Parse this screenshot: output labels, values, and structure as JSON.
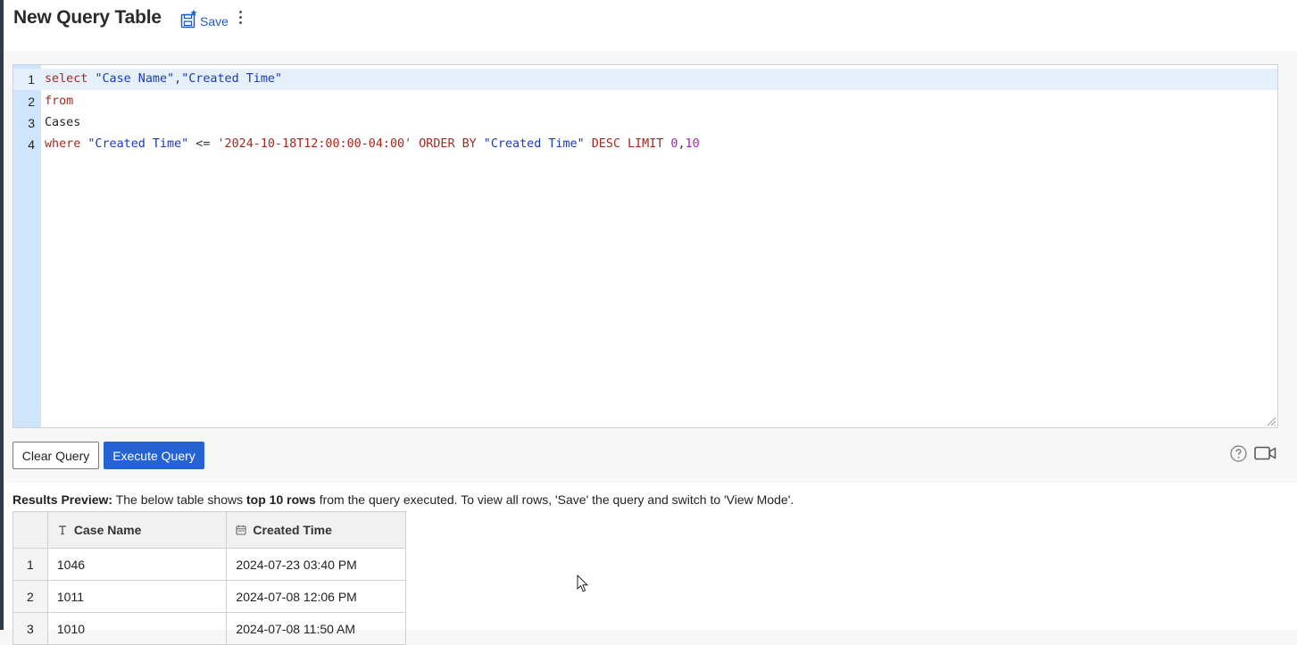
{
  "header": {
    "title": "New Query Table",
    "save_label": "Save"
  },
  "editor": {
    "lines": [
      {
        "number": "1"
      },
      {
        "number": "2"
      },
      {
        "number": "3"
      },
      {
        "number": "4"
      }
    ],
    "tokens": {
      "l1_kw": "select ",
      "l1_s1": "\"Case Name\"",
      "l1_comma": ",",
      "l1_s2": "\"Created Time\"",
      "l2_kw": "from",
      "l3_plain": "Cases",
      "l4_kw1": "where ",
      "l4_s1": "\"Created Time\"",
      "l4_op": " <= ",
      "l4_date": "'2024-10-18T12:00:00-04:00'",
      "l4_kw2": " ORDER BY ",
      "l4_s2": "\"Created Time\"",
      "l4_kw3": " DESC LIMIT ",
      "l4_n1": "0",
      "l4_comma": ",",
      "l4_n2": "10"
    }
  },
  "buttons": {
    "clear": "Clear Query",
    "execute": "Execute Query"
  },
  "results": {
    "note_label": "Results Preview:",
    "note_part1": " The below table shows ",
    "note_bold": "top 10 rows",
    "note_part2": " from the query executed. To view all rows, 'Save' the query and switch to 'View Mode'.",
    "columns": [
      "Case Name",
      "Created Time"
    ],
    "rows": [
      {
        "idx": "1",
        "case_name": "1046",
        "created_time": "2024-07-23 03:40 PM"
      },
      {
        "idx": "2",
        "case_name": "1011",
        "created_time": "2024-07-08 12:06 PM"
      },
      {
        "idx": "3",
        "case_name": "1010",
        "created_time": "2024-07-08 11:50 AM"
      }
    ]
  },
  "colors": {
    "accent": "#2563d3",
    "gutter": "#cfe5fb",
    "keyword": "#a6281f",
    "string": "#1a39b8",
    "number": "#b01cc2"
  },
  "icons": {
    "save": "save-star-icon",
    "more": "kebab-menu-icon",
    "help": "help-icon",
    "video": "video-camera-icon",
    "text_column": "text-type-icon",
    "date_column": "calendar-icon"
  }
}
